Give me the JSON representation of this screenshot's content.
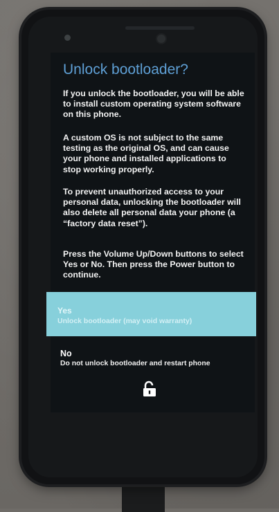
{
  "screen": {
    "title": "Unlock bootloader?",
    "paragraphs": [
      "If you unlock the bootloader, you will be able to install custom operating system software on this phone.",
      "A custom OS is not subject to the same testing as the original OS, and can cause your phone and installed applications to stop working properly.",
      "To prevent unauthorized access to your personal data, unlocking the bootloader will also delete all personal data your phone (a “factory data reset”).",
      "Press the Volume Up/Down buttons to select Yes or No. Then press the Power button to continue."
    ],
    "options": {
      "yes": {
        "label": "Yes",
        "description": "Unlock bootloader (may void warranty)"
      },
      "no": {
        "label": "No",
        "description": "Do not unlock bootloader and restart phone"
      }
    },
    "icon": "unlock-padlock-icon"
  },
  "colors": {
    "title": "#5fa0d6",
    "highlight": "#87d0db",
    "screen_bg": "#0f1316"
  }
}
